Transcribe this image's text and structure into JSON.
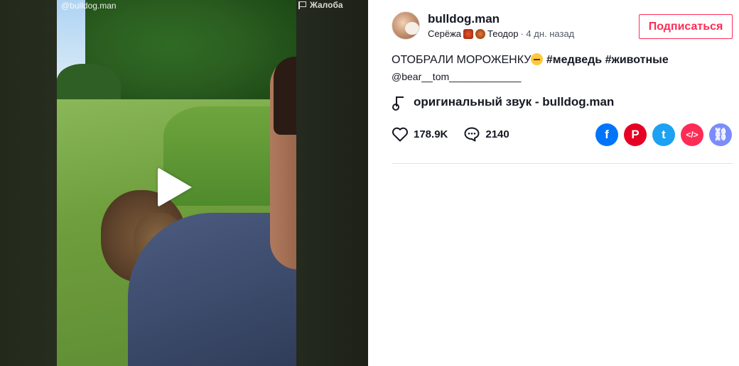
{
  "video": {
    "handle": "@bulldog.man",
    "report_label": "Жалоба"
  },
  "author": {
    "username": "bulldog.man",
    "nickname_a": "Серёжа",
    "nickname_b": "Теодор",
    "posted": "· 4 дн. назад"
  },
  "follow_label": "Подписаться",
  "caption": {
    "text": "ОТОБРАЛИ МОРОЖЕНКУ",
    "tag1": "#медведь",
    "tag2": "#животные",
    "mention": "@bear__tom_____________"
  },
  "sound": {
    "label": "оригинальный звук - bulldog.man"
  },
  "stats": {
    "likes": "178.9K",
    "comments": "2140"
  },
  "share": {
    "facebook_icon": "facebook-icon",
    "pinterest_icon": "pinterest-icon",
    "twitter_icon": "twitter-icon",
    "embed_icon": "embed-icon",
    "link_icon": "link-icon",
    "fb_glyph": "f",
    "pin_glyph": "P",
    "tw_glyph": "t",
    "emb_glyph": "</>",
    "lnk_glyph": "⛓"
  },
  "colors": {
    "accent": "#fe2c55",
    "text": "#161823"
  }
}
